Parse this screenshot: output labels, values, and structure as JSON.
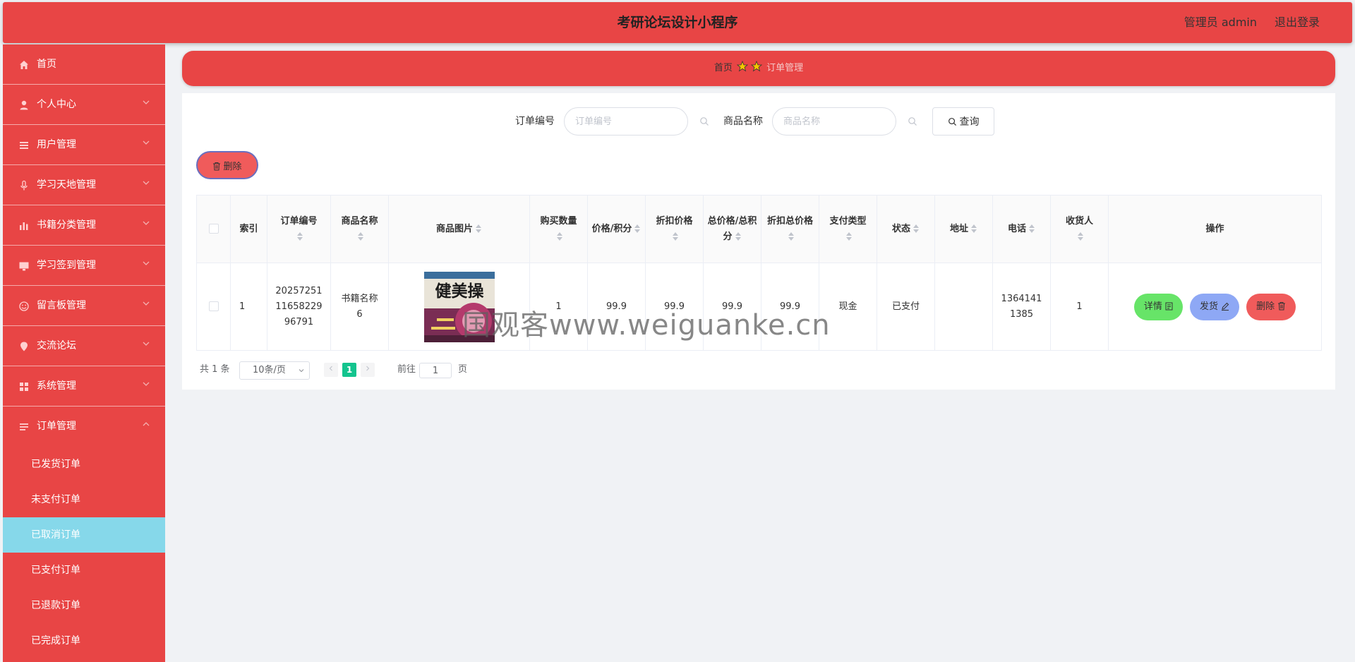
{
  "header": {
    "title": "考研论坛设计小程序",
    "admin_label": "管理员 admin",
    "logout_label": "退出登录"
  },
  "sidebar": {
    "items": [
      {
        "label": "首页",
        "icon": "home-icon",
        "has_arrow": false
      },
      {
        "label": "个人中心",
        "icon": "user-icon",
        "has_arrow": true
      },
      {
        "label": "用户管理",
        "icon": "list-icon",
        "has_arrow": true
      },
      {
        "label": "学习天地管理",
        "icon": "microphone-icon",
        "has_arrow": true
      },
      {
        "label": "书籍分类管理",
        "icon": "bar-chart-icon",
        "has_arrow": true
      },
      {
        "label": "学习签到管理",
        "icon": "monitor-icon",
        "has_arrow": true
      },
      {
        "label": "留言板管理",
        "icon": "smile-icon",
        "has_arrow": true
      },
      {
        "label": "交流论坛",
        "icon": "location-icon",
        "has_arrow": true
      },
      {
        "label": "系统管理",
        "icon": "grid-icon",
        "has_arrow": true
      },
      {
        "label": "订单管理",
        "icon": "order-list-icon",
        "has_arrow": true,
        "open": true
      }
    ],
    "sub_items": [
      "已发货订单",
      "未支付订单",
      "已取消订单",
      "已支付订单",
      "已退款订单",
      "已完成订单"
    ],
    "active_sub": "已取消订单"
  },
  "breadcrumb": {
    "home": "首页",
    "current": "订单管理"
  },
  "search": {
    "order_label": "订单编号",
    "order_placeholder": "订单编号",
    "product_label": "商品名称",
    "product_placeholder": "商品名称",
    "query_label": "查询"
  },
  "toolbar": {
    "delete_label": "删除"
  },
  "table": {
    "columns": [
      "索引",
      "订单编号",
      "商品名称",
      "商品图片",
      "购买数量",
      "价格/积分",
      "折扣价格",
      "总价格/总积分",
      "折扣总价格",
      "支付类型",
      "状态",
      "地址",
      "电话",
      "收货人",
      "操作"
    ],
    "rows": [
      {
        "index": "1",
        "order_no": "202572511165822996791",
        "product_name": "书籍名称6",
        "image_title": "健美操",
        "quantity": "1",
        "price": "99.9",
        "discount_price": "99.9",
        "total_price": "99.9",
        "discount_total": "99.9",
        "pay_type": "现金",
        "status": "已支付",
        "address": "",
        "phone": "13641411385",
        "receiver": "1"
      }
    ],
    "actions": {
      "detail": "详情",
      "ship": "发货",
      "delete": "删除"
    }
  },
  "pagination": {
    "total": "共 1 条",
    "page_size": "10条/页",
    "current_page": "1",
    "goto_label": "前往",
    "goto_value": "1",
    "page_suffix": "页"
  },
  "watermark": "国观客www.weiguanke.cn",
  "colors": {
    "primary": "#e84545",
    "active_sub": "#86d8ea",
    "detail_btn": "#67e468",
    "ship_btn": "#8ea8f5",
    "delete_btn": "#f05b5b",
    "pager_active": "#13c48e"
  }
}
